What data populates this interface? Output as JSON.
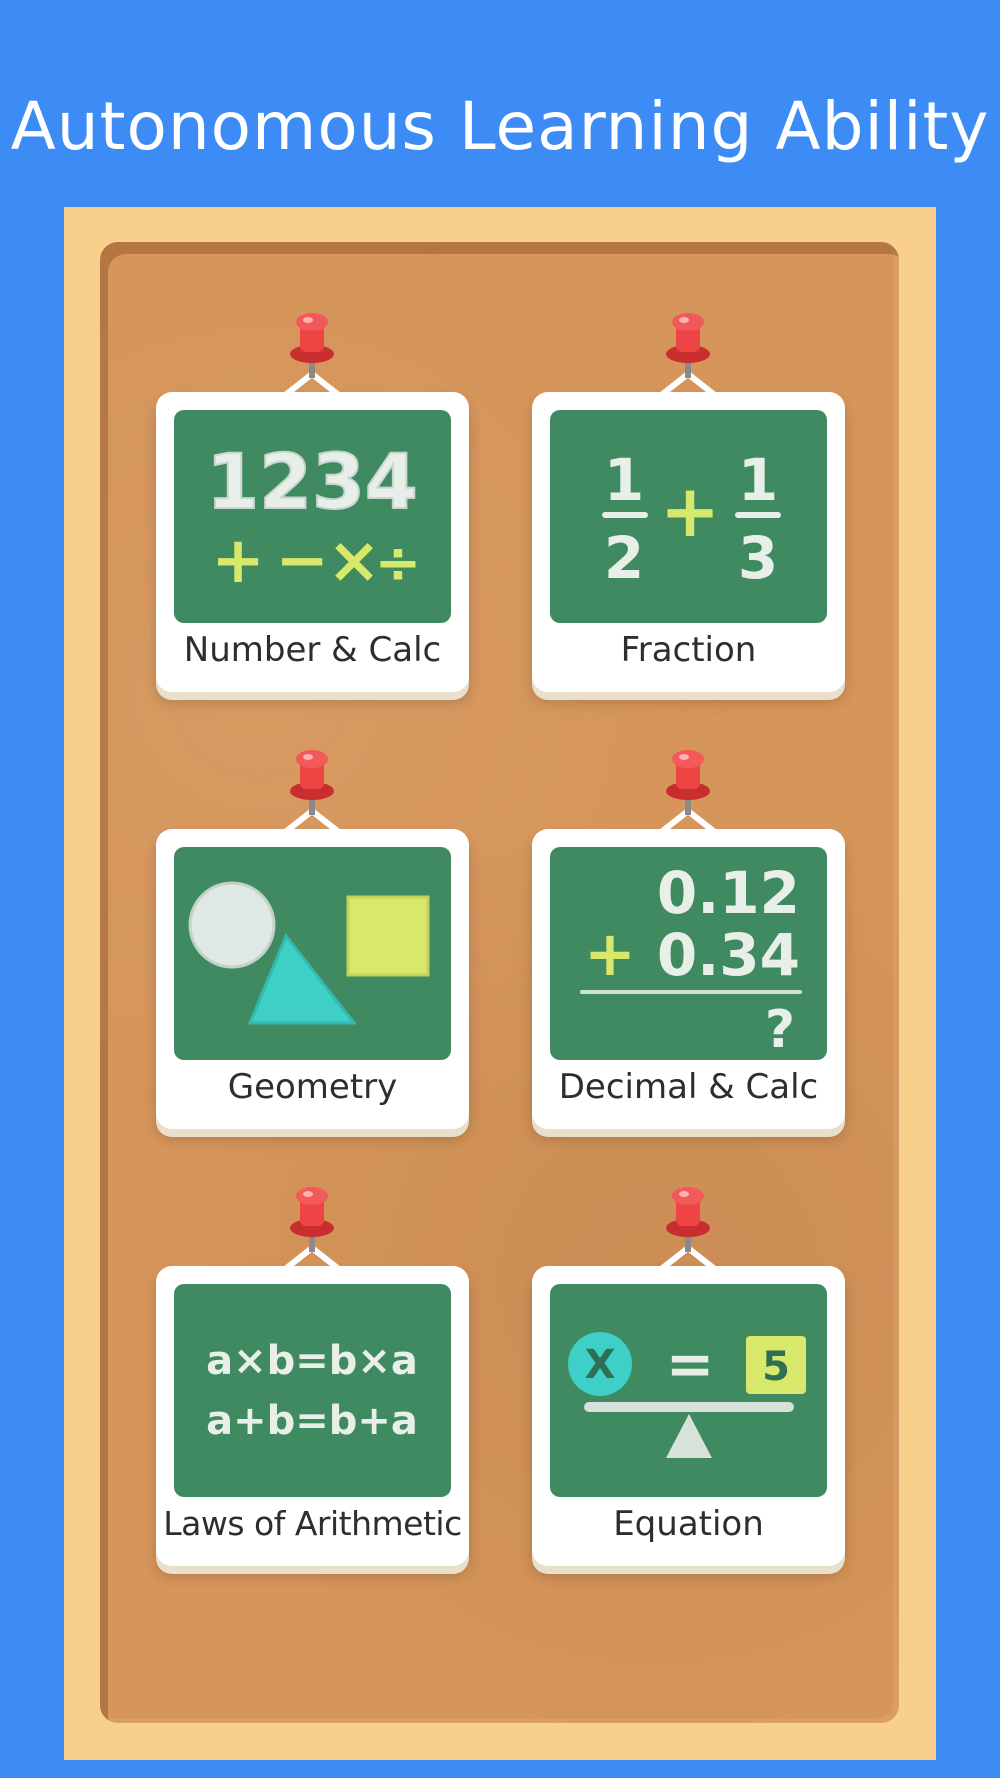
{
  "title": "Autonomous Learning Ability",
  "cards": [
    {
      "label": "Number & Calc",
      "digits": "1234",
      "ops": [
        "+",
        "−",
        "×",
        "÷"
      ]
    },
    {
      "label": "Fraction",
      "num1": "1",
      "den1": "2",
      "op": "+",
      "num2": "1",
      "den2": "3"
    },
    {
      "label": "Geometry"
    },
    {
      "label": "Decimal & Calc",
      "line1": "0.12",
      "op": "+",
      "line2": "0.34",
      "result": "?"
    },
    {
      "label": "Laws of Arithmetic",
      "line1": "a×b=b×a",
      "line2": "a+b=b+a"
    },
    {
      "label": "Equation",
      "variable": "X",
      "equals": "=",
      "value": "5"
    }
  ],
  "colors": {
    "background": "#3d8cf6",
    "frame": "#f8d08c",
    "cork": "#d6955a",
    "chalkboard": "#3f8a60",
    "chalk_white": "#e8efe9",
    "chalk_yellow": "#d8e86a",
    "chalk_cyan": "#3ecfc6",
    "pin_red": "#ee4444"
  }
}
